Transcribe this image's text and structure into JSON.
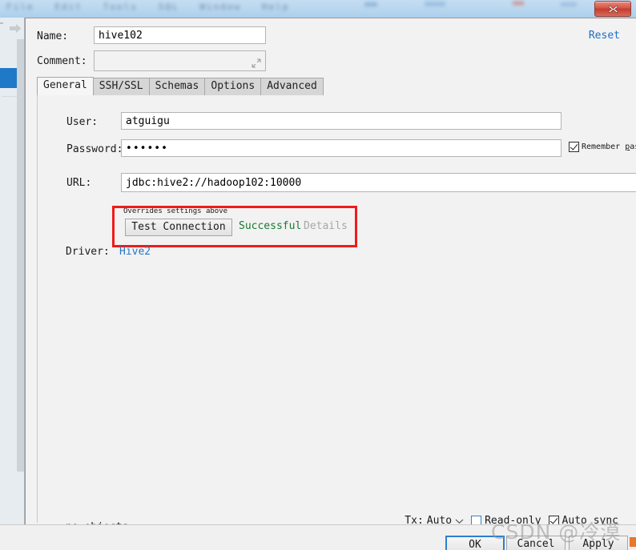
{
  "window": {
    "menubar_blurred_items": [
      "File",
      "Edit",
      "Tools",
      "SQL",
      "Window",
      "Help"
    ],
    "close_icon": "close-icon"
  },
  "sidebar": {
    "arrow_icon": "arrow-right-icon",
    "selected_item": ""
  },
  "header": {
    "name_label": "Name:",
    "name_value": "hive102",
    "comment_label": "Comment:",
    "comment_value": "",
    "comment_placeholder": "",
    "expand_icon": "expand-diagonal-icon",
    "reset_label": "Reset"
  },
  "tabs": [
    {
      "label": "General",
      "active": true
    },
    {
      "label": "SSH/SSL",
      "active": false
    },
    {
      "label": "Schemas",
      "active": false
    },
    {
      "label": "Options",
      "active": false
    },
    {
      "label": "Advanced",
      "active": false
    }
  ],
  "general": {
    "user_label": "User:",
    "user_value": "atguigu",
    "password_label": "Password:",
    "password_value": "••••••",
    "remember_password_label": "Remember password",
    "remember_password_checked": true,
    "url_label": "URL:",
    "url_value": "jdbc:hive2://hadoop102:10000",
    "overrides_hint": "Overrides settings above",
    "test_connection_label": "Test Connection",
    "test_status": "Successful",
    "test_details_label": "Details",
    "driver_label": "Driver:",
    "driver_value": "Hive2",
    "no_objects_label": "no objects"
  },
  "bottom_options": {
    "tx_label": "Tx:",
    "tx_value": "Auto",
    "tx_chevron_icon": "chevron-down-icon",
    "read_only_label": "Read-only",
    "read_only_checked": false,
    "auto_sync_label": "Auto sync",
    "auto_sync_checked": true
  },
  "footer": {
    "ok_label": "OK",
    "cancel_label": "Cancel",
    "apply_label": "Apply"
  },
  "watermark": {
    "text": "CSDN @冷漠"
  },
  "colors": {
    "accent_blue": "#2079c7",
    "link_blue": "#2a77c4",
    "success_green": "#1a7a2e",
    "annotation_red": "#ee1c19",
    "dialog_bg": "#f2f2f2",
    "close_red": "#c23d2f"
  }
}
